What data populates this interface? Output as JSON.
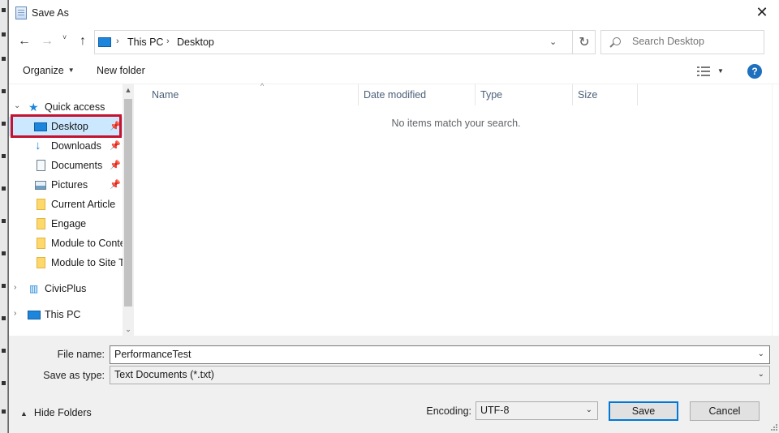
{
  "window": {
    "title": "Save As"
  },
  "nav": {
    "back_icon": "back-arrow-icon",
    "forward_icon": "forward-arrow-icon",
    "up_icon": "up-arrow-icon",
    "breadcrumbs": [
      "This PC",
      "Desktop"
    ],
    "refresh_icon": "refresh-icon"
  },
  "search": {
    "placeholder": "Search Desktop"
  },
  "toolbar": {
    "organize_label": "Organize",
    "new_folder_label": "New folder"
  },
  "sidebar": {
    "items": [
      {
        "label": "Quick access",
        "icon": "star-icon"
      },
      {
        "label": "Desktop",
        "icon": "desktop-icon",
        "pinned": true,
        "selected": true
      },
      {
        "label": "Downloads",
        "icon": "download-icon",
        "pinned": true
      },
      {
        "label": "Documents",
        "icon": "documents-icon",
        "pinned": true
      },
      {
        "label": "Pictures",
        "icon": "pictures-icon",
        "pinned": true
      },
      {
        "label": "Current Article",
        "icon": "folder-icon"
      },
      {
        "label": "Engage",
        "icon": "folder-icon"
      },
      {
        "label": "Module to Conte",
        "icon": "folder-icon"
      },
      {
        "label": "Module to Site T",
        "icon": "folder-icon"
      },
      {
        "label": "CivicPlus",
        "icon": "building-icon"
      },
      {
        "label": "This PC",
        "icon": "pc-icon"
      }
    ]
  },
  "columns": [
    "Name",
    "Date modified",
    "Type",
    "Size"
  ],
  "empty_message": "No items match your search.",
  "form": {
    "file_name_label": "File name:",
    "file_name_value": "PerformanceTest",
    "save_type_label": "Save as type:",
    "save_type_value": "Text Documents (*.txt)",
    "encoding_label": "Encoding:",
    "encoding_value": "UTF-8"
  },
  "buttons": {
    "hide_folders": "Hide Folders",
    "save": "Save",
    "cancel": "Cancel"
  },
  "colors": {
    "accent": "#0078d7",
    "selection": "#cce8ff",
    "highlight_border": "#c4122f"
  }
}
